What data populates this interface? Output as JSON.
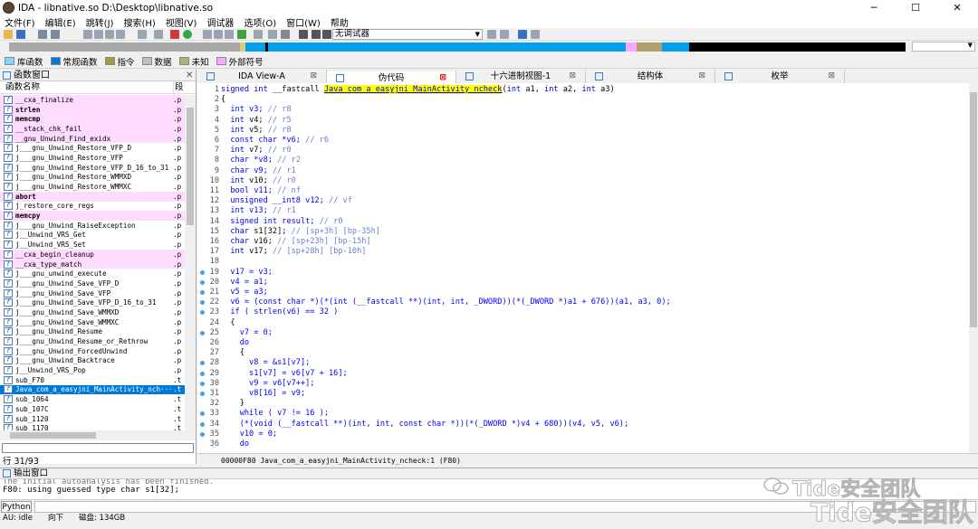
{
  "window": {
    "title": "IDA - libnative.so D:\\Desktop\\libnative.so",
    "min_icon": "minimize-icon",
    "max_icon": "maximize-icon",
    "close_icon": "close-icon"
  },
  "menu": [
    "文件(F)",
    "编辑(E)",
    "跳转(J)",
    "搜索(H)",
    "视图(V)",
    "调试器",
    "选项(O)",
    "窗口(W)",
    "帮助"
  ],
  "toolbar": {
    "debugger_select": "无调试器"
  },
  "legend": [
    {
      "label": "库函数",
      "color": "#7fd7ff"
    },
    {
      "label": "常规函数",
      "color": "#0078d7"
    },
    {
      "label": "指令",
      "color": "#a0a040"
    },
    {
      "label": "数据",
      "color": "#c0c0c0"
    },
    {
      "label": "未知",
      "color": "#b0b070"
    },
    {
      "label": "外部符号",
      "color": "#ffa6ff"
    }
  ],
  "functions_panel": {
    "title": "函数窗口",
    "col_name": "函数名称",
    "col_seg": "段",
    "rows": [
      {
        "name": "__cxa_finalize",
        "seg": ".p",
        "type": "lib",
        "bold": false
      },
      {
        "name": "strlen",
        "seg": ".p",
        "type": "lib",
        "bold": true
      },
      {
        "name": "memcmp",
        "seg": ".p",
        "type": "lib",
        "bold": true
      },
      {
        "name": "__stack_chk_fail",
        "seg": ".p",
        "type": "lib",
        "bold": false
      },
      {
        "name": "__gnu_Unwind_Find_exidx",
        "seg": ".p",
        "type": "lib",
        "bold": false
      },
      {
        "name": "j___gnu_Unwind_Restore_VFP_D",
        "seg": ".p",
        "type": "normal",
        "bold": false
      },
      {
        "name": "j___gnu_Unwind_Restore_VFP",
        "seg": ".p",
        "type": "normal",
        "bold": false
      },
      {
        "name": "j___gnu_Unwind_Restore_VFP_D_16_to_31",
        "seg": ".p",
        "type": "normal",
        "bold": false
      },
      {
        "name": "j___gnu_Unwind_Restore_WMMXD",
        "seg": ".p",
        "type": "normal",
        "bold": false
      },
      {
        "name": "j___gnu_Unwind_Restore_WMMXC",
        "seg": ".p",
        "type": "normal",
        "bold": false
      },
      {
        "name": "abort",
        "seg": ".p",
        "type": "lib",
        "bold": true
      },
      {
        "name": "j_restore_core_regs",
        "seg": ".p",
        "type": "normal",
        "bold": false
      },
      {
        "name": "memcpy",
        "seg": ".p",
        "type": "lib",
        "bold": true
      },
      {
        "name": "j___gnu_Unwind_RaiseException",
        "seg": ".p",
        "type": "normal",
        "bold": false
      },
      {
        "name": "j__Unwind_VRS_Get",
        "seg": ".p",
        "type": "normal",
        "bold": false
      },
      {
        "name": "j__Unwind_VRS_Set",
        "seg": ".p",
        "type": "normal",
        "bold": false
      },
      {
        "name": "__cxa_begin_cleanup",
        "seg": ".p",
        "type": "lib",
        "bold": false
      },
      {
        "name": "__cxa_type_match",
        "seg": ".p",
        "type": "lib",
        "bold": false
      },
      {
        "name": "j___gnu_unwind_execute",
        "seg": ".p",
        "type": "normal",
        "bold": false
      },
      {
        "name": "j___gnu_Unwind_Save_VFP_D",
        "seg": ".p",
        "type": "normal",
        "bold": false
      },
      {
        "name": "j___gnu_Unwind_Save_VFP",
        "seg": ".p",
        "type": "normal",
        "bold": false
      },
      {
        "name": "j___gnu_Unwind_Save_VFP_D_16_to_31",
        "seg": ".p",
        "type": "normal",
        "bold": false
      },
      {
        "name": "j___gnu_Unwind_Save_WMMXD",
        "seg": ".p",
        "type": "normal",
        "bold": false
      },
      {
        "name": "j___gnu_Unwind_Save_WMMXC",
        "seg": ".p",
        "type": "normal",
        "bold": false
      },
      {
        "name": "j___gnu_Unwind_Resume",
        "seg": ".p",
        "type": "normal",
        "bold": false
      },
      {
        "name": "j___gnu_Unwind_Resume_or_Rethrow",
        "seg": ".p",
        "type": "normal",
        "bold": false
      },
      {
        "name": "j___gnu_Unwind_ForcedUnwind",
        "seg": ".p",
        "type": "normal",
        "bold": false
      },
      {
        "name": "j___gnu_Unwind_Backtrace",
        "seg": ".p",
        "type": "normal",
        "bold": false
      },
      {
        "name": "j__Unwind_VRS_Pop",
        "seg": ".p",
        "type": "normal",
        "bold": false
      },
      {
        "name": "sub_F70",
        "seg": ".t",
        "type": "normal",
        "bold": false
      },
      {
        "name": "Java_com_a_easyjni_MainActivity_nch···",
        "seg": ".t",
        "type": "selected",
        "bold": false
      },
      {
        "name": "sub_1064",
        "seg": ".t",
        "type": "normal",
        "bold": false
      },
      {
        "name": "sub_107C",
        "seg": ".t",
        "type": "normal",
        "bold": false
      },
      {
        "name": "sub_1120",
        "seg": ".t",
        "type": "normal",
        "bold": false
      },
      {
        "name": "sub_1170",
        "seg": ".t",
        "type": "normal",
        "bold": false
      }
    ],
    "status": "行 31/93"
  },
  "tabs": [
    {
      "label": "IDA View-A",
      "icon": "ida-view-icon",
      "active": false
    },
    {
      "label": "伪代码",
      "icon": "pseudocode-icon",
      "active": true
    },
    {
      "label": "十六进制视图-1",
      "icon": "hex-view-icon",
      "active": false
    },
    {
      "label": "结构体",
      "icon": "structures-icon",
      "active": false
    },
    {
      "label": "枚举",
      "icon": "enums-icon",
      "active": false
    }
  ],
  "code": {
    "lines": [
      {
        "n": "1",
        "dot": false,
        "html": "<span class=\"kw\">signed int</span> __fastcall <span class=\"hl\">Java_com_a_easyjni_MainActivity_ncheck</span>(<span class=\"kw\">int</span> a1, <span class=\"kw\">int</span> a2, <span class=\"kw\">int</span> a3)"
      },
      {
        "n": "2",
        "dot": false,
        "html": "{"
      },
      {
        "n": "3",
        "dot": false,
        "html": "  <span class=\"vr\">int v3;</span> <span class=\"cm\">// r8</span>"
      },
      {
        "n": "4",
        "dot": false,
        "html": "  <span class=\"kw\">int</span> v4; <span class=\"cm\">// r5</span>"
      },
      {
        "n": "5",
        "dot": false,
        "html": "  <span class=\"kw\">int</span> v5; <span class=\"cm\">// r8</span>"
      },
      {
        "n": "6",
        "dot": false,
        "html": "  <span class=\"vr\">const char *v6;</span> <span class=\"cm\">// r6</span>"
      },
      {
        "n": "7",
        "dot": false,
        "html": "  <span class=\"kw\">int</span> v7; <span class=\"cm\">// r0</span>"
      },
      {
        "n": "8",
        "dot": false,
        "html": "  <span class=\"vr\">char *v8;</span> <span class=\"cm\">// r2</span>"
      },
      {
        "n": "9",
        "dot": false,
        "html": "  <span class=\"vr\">char v9;</span> <span class=\"cm\">// r1</span>"
      },
      {
        "n": "10",
        "dot": false,
        "html": "  <span class=\"kw\">int</span> v10; <span class=\"cm\">// r0</span>"
      },
      {
        "n": "11",
        "dot": false,
        "html": "  <span class=\"vr\">bool v11;</span> <span class=\"cm\">// nf</span>"
      },
      {
        "n": "12",
        "dot": false,
        "html": "  <span class=\"vr\">unsigned __int8 v12;</span> <span class=\"cm\">// vf</span>"
      },
      {
        "n": "13",
        "dot": false,
        "html": "  <span class=\"vr\">int v13;</span> <span class=\"cm\">// r1</span>"
      },
      {
        "n": "14",
        "dot": false,
        "html": "  <span class=\"vr\">signed int result;</span> <span class=\"cm\">// r0</span>"
      },
      {
        "n": "15",
        "dot": false,
        "html": "  <span class=\"kw\">char</span> s1[32]; <span class=\"cm\">// [sp+3h] [bp-35h]</span>"
      },
      {
        "n": "16",
        "dot": false,
        "html": "  <span class=\"kw\">char</span> v16; <span class=\"cm\">// [sp+23h] [bp-15h]</span>"
      },
      {
        "n": "17",
        "dot": false,
        "html": "  <span class=\"kw\">int</span> v17; <span class=\"cm\">// [sp+28h] [bp-10h]</span>"
      },
      {
        "n": "18",
        "dot": false,
        "html": ""
      },
      {
        "n": "19",
        "dot": true,
        "html": "  <span class=\"vr\">v17 = v3;</span>"
      },
      {
        "n": "20",
        "dot": true,
        "html": "  <span class=\"vr\">v4 = a1;</span>"
      },
      {
        "n": "21",
        "dot": true,
        "html": "  <span class=\"vr\">v5 = a3;</span>"
      },
      {
        "n": "22",
        "dot": true,
        "html": "  <span class=\"vr\">v6 = (const char *)(*(int (__fastcall **)(int, int, _DWORD))(*(_DWORD *)a1 + 676))(a1, a3, 0);</span>"
      },
      {
        "n": "23",
        "dot": true,
        "html": "  <span class=\"vr\">if ( strlen(v6) == 32 )</span>"
      },
      {
        "n": "24",
        "dot": false,
        "html": "  {"
      },
      {
        "n": "25",
        "dot": true,
        "html": "    <span class=\"vr\">v7 = 0;</span>"
      },
      {
        "n": "26",
        "dot": false,
        "html": "    <span class=\"vr\">do</span>"
      },
      {
        "n": "27",
        "dot": false,
        "html": "    {"
      },
      {
        "n": "28",
        "dot": true,
        "html": "      <span class=\"vr\">v8 = &amp;s1[v7];</span>"
      },
      {
        "n": "29",
        "dot": true,
        "html": "      <span class=\"vr\">s1[v7] = v6[v7 + 16];</span>"
      },
      {
        "n": "30",
        "dot": true,
        "html": "      <span class=\"vr\">v9 = v6[v7++];</span>"
      },
      {
        "n": "31",
        "dot": true,
        "html": "      <span class=\"vr\">v8[16] = v9;</span>"
      },
      {
        "n": "32",
        "dot": false,
        "html": "    }"
      },
      {
        "n": "33",
        "dot": true,
        "html": "    <span class=\"vr\">while ( v7 != 16 );</span>"
      },
      {
        "n": "34",
        "dot": true,
        "html": "    <span class=\"vr\">(*(void (__fastcall **)(int, int, const char *))(*(_DWORD *)v4 + 680))(v4, v5, v6);</span>"
      },
      {
        "n": "35",
        "dot": true,
        "html": "    <span class=\"vr\">v10 = 0;</span>"
      },
      {
        "n": "36",
        "dot": false,
        "html": "    <span class=\"vr\">do</span>"
      }
    ],
    "status": "00000F80 Java_com_a_easyjni_MainActivity_ncheck:1 (F80)"
  },
  "output": {
    "title": "输出窗口",
    "lines": [
      "The initial autoanalysis has been finished.",
      "F80: using guessed type char s1[32];"
    ]
  },
  "python_btn": "Python",
  "statusbar": [
    "AU:  idle",
    "向下",
    "磁盘: 134GB"
  ],
  "watermark": {
    "line1": "Tide安全团队",
    "line2": "Tide安全团队"
  }
}
